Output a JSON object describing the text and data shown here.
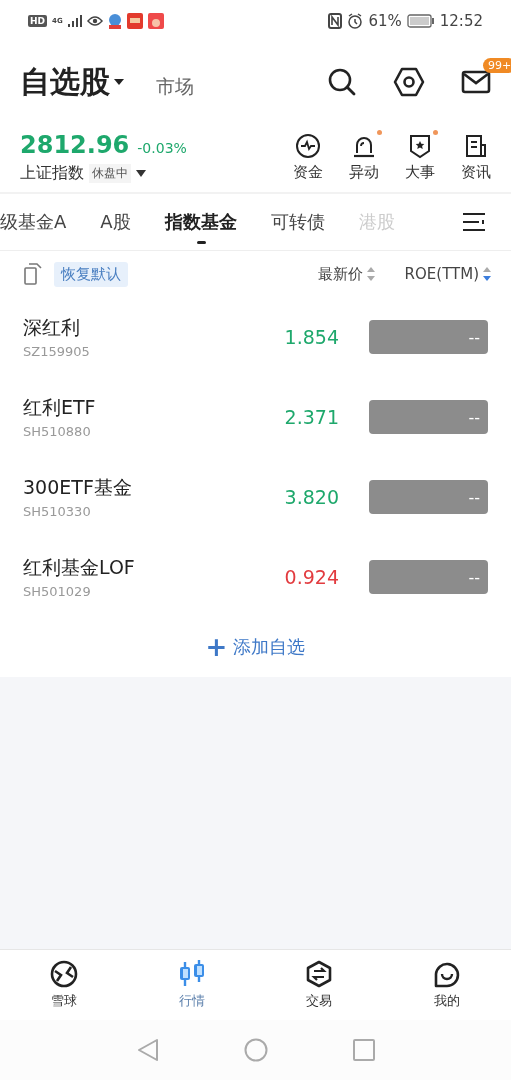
{
  "status_bar": {
    "hd": "HD",
    "network": "4G",
    "battery": "61%",
    "time": "12:52"
  },
  "header": {
    "title": "自选股",
    "market_tab": "市场",
    "mail_badge": "99+"
  },
  "index": {
    "value": "2812.96",
    "change": "-0.03%",
    "color": "#1ea86c",
    "name": "上证指数",
    "status": "休盘中"
  },
  "shortcuts": [
    {
      "kind": "funds",
      "label": "资金",
      "dot": false
    },
    {
      "kind": "alert",
      "label": "异动",
      "dot": true
    },
    {
      "kind": "events",
      "label": "大事",
      "dot": true
    },
    {
      "kind": "news",
      "label": "资讯",
      "dot": false
    }
  ],
  "tabs": [
    {
      "label": "级基金A",
      "selected": false,
      "faded": false
    },
    {
      "label": "A股",
      "selected": false,
      "faded": false
    },
    {
      "label": "指数基金",
      "selected": true,
      "faded": false
    },
    {
      "label": "可转债",
      "selected": false,
      "faded": false
    },
    {
      "label": "港股",
      "selected": false,
      "faded": true
    }
  ],
  "table": {
    "reset": "恢复默认",
    "columns": [
      {
        "label": "最新价",
        "sorted": false
      },
      {
        "label": "ROE(TTM)",
        "sorted": true
      }
    ],
    "rows": [
      {
        "name": "深红利",
        "code": "SZ159905",
        "price": "1.854",
        "color": "#1ea86c",
        "roe": "--"
      },
      {
        "name": "红利ETF",
        "code": "SH510880",
        "price": "2.371",
        "color": "#1ea86c",
        "roe": "--"
      },
      {
        "name": "300ETF基金",
        "code": "SH510330",
        "price": "3.820",
        "color": "#1ea86c",
        "roe": "--"
      },
      {
        "name": "红利基金LOF",
        "code": "SH501029",
        "price": "0.924",
        "color": "#e23b3f",
        "roe": "--"
      }
    ]
  },
  "add_button": {
    "icon": "+",
    "label": "添加自选"
  },
  "bottom_nav": [
    {
      "kind": "ball",
      "label": "雪球",
      "selected": false
    },
    {
      "kind": "candles",
      "label": "行情",
      "selected": true
    },
    {
      "kind": "trade",
      "label": "交易",
      "selected": false
    },
    {
      "kind": "me",
      "label": "我的",
      "selected": false
    }
  ]
}
